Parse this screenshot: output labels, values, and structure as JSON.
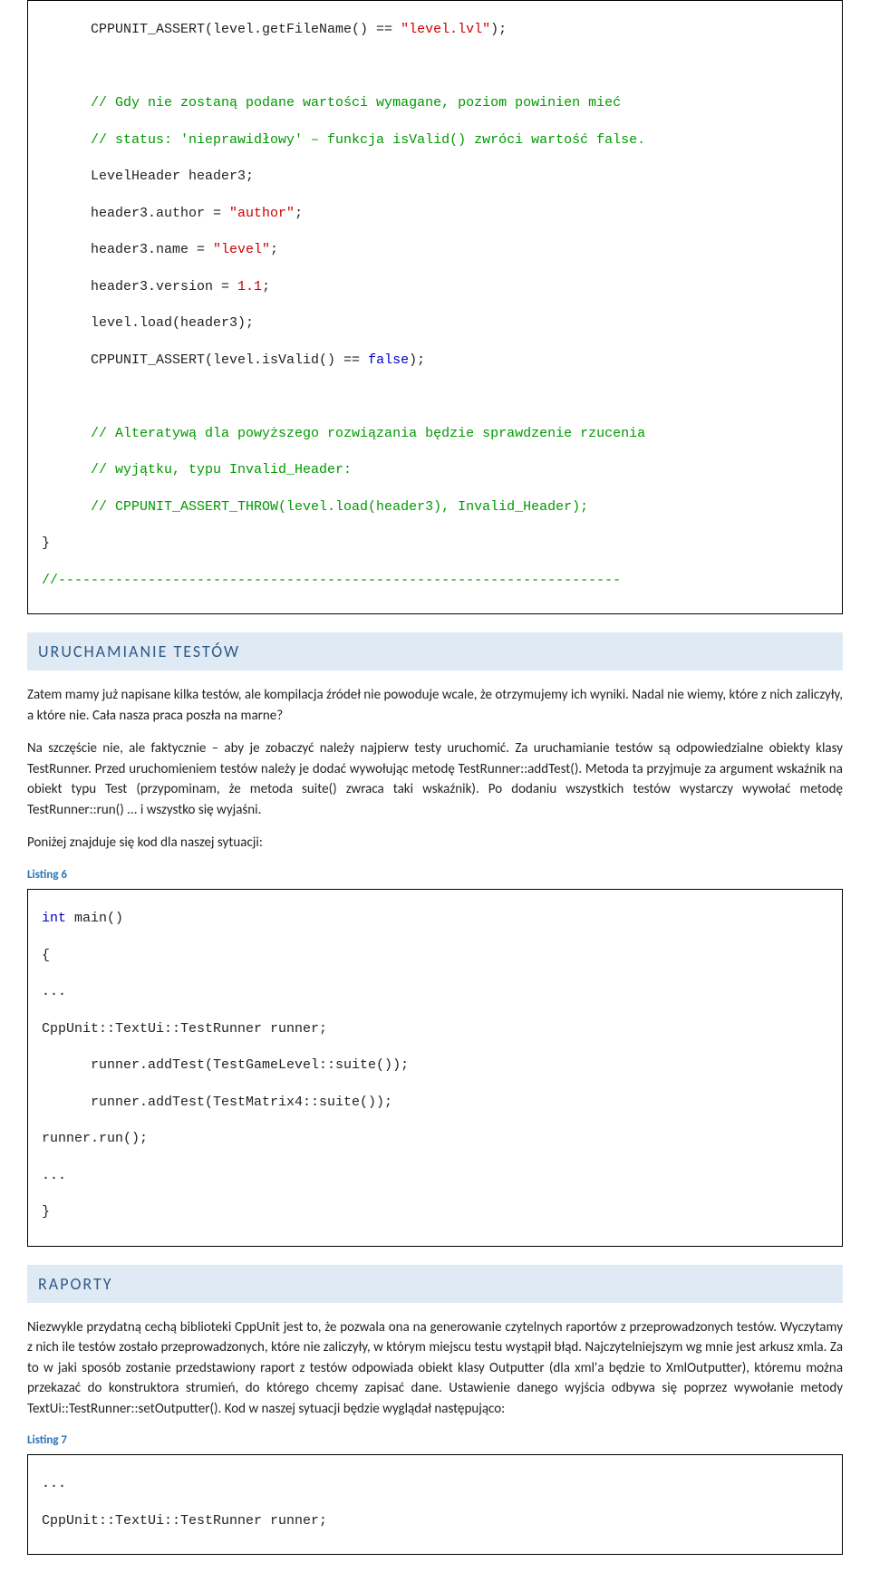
{
  "code1": {
    "l01a": "      CPPUNIT_ASSERT(level.getFileName() == ",
    "l01b": "\"level.lvl\"",
    "l01c": ");",
    "l03": "      // Gdy nie zostaną podane wartości wymagane, poziom powinien mieć",
    "l04": "      // status: 'nieprawidłowy' – funkcja isValid() zwróci wartość false.",
    "l05": "      LevelHeader header3;",
    "l06a": "      header3.author = ",
    "l06b": "\"author\"",
    "l06c": ";",
    "l07a": "      header3.name = ",
    "l07b": "\"level\"",
    "l07c": ";",
    "l08a": "      header3.version = ",
    "l08b": "1.1",
    "l08c": ";",
    "l09": "      level.load(header3);",
    "l10a": "      CPPUNIT_ASSERT(level.isValid() == ",
    "l10b": "false",
    "l10c": ");",
    "l12": "      // Alteratywą dla powyższego rozwiązania będzie sprawdzenie rzucenia",
    "l13": "      // wyjątku, typu Invalid_Header:",
    "l14": "      // CPPUNIT_ASSERT_THROW(level.load(header3), Invalid_Header);",
    "l15": "}",
    "l16": "//---------------------------------------------------------------------"
  },
  "sections": {
    "run_title": "URUCHAMIANIE TESTÓW",
    "reports_title": "RAPORTY"
  },
  "paras": {
    "p1": "Zatem mamy już napisane kilka testów, ale kompilacja źródeł nie powoduje wcale, że otrzymujemy ich wyniki. Nadal nie wiemy, które z nich zaliczyły, a które nie. Cała nasza praca poszła na marne?",
    "p2": "Na szczęście nie, ale faktycznie – aby je zobaczyć należy najpierw testy uruchomić. Za uruchamianie testów są odpowiedzialne obiekty klasy TestRunner. Przed uruchomieniem testów należy je dodać wywołując metodę TestRunner::addTest(). Metoda ta przyjmuje za argument wskaźnik na obiekt typu Test (przypominam, że metoda suite() zwraca taki wskaźnik). Po dodaniu wszystkich testów wystarczy wywołać metodę TestRunner::run() ... i wszystko się wyjaśni.",
    "p3": "Poniżej znajduje się kod dla naszej sytuacji:",
    "p4": "Niezwykle przydatną cechą biblioteki CppUnit jest to, że pozwala ona na generowanie czytelnych raportów z przeprowadzonych testów. Wyczytamy z nich ile testów zostało przeprowadzonych, które nie zaliczyły, w którym miejscu testu wystąpił błąd. Najczytelniejszym wg mnie jest arkusz xmla. Za to w jaki sposób zostanie przedstawiony raport z testów odpowiada obiekt klasy Outputter (dla xml'a będzie to XmlOutputter), któremu można przekazać do konstruktora strumień, do którego chcemy zapisać dane. Ustawienie danego wyjścia odbywa się poprzez wywołanie metody TextUi::TestRunner::setOutputter(). Kod w naszej sytuacji będzie wyglądał następująco:"
  },
  "listing6_label": "Listing 6",
  "code2": {
    "l1a": "int",
    "l1b": " main()",
    "l2": "{",
    "l3": "...",
    "l4": "CppUnit::TextUi::TestRunner runner;",
    "l5": "      runner.addTest(TestGameLevel::suite());",
    "l6": "      runner.addTest(TestMatrix4::suite());",
    "l7": "runner.run();",
    "l8": "...",
    "l9": "}"
  },
  "listing7_label": "Listing 7",
  "code3": {
    "l1": "...",
    "l2": "CppUnit::TextUi::TestRunner runner;"
  }
}
